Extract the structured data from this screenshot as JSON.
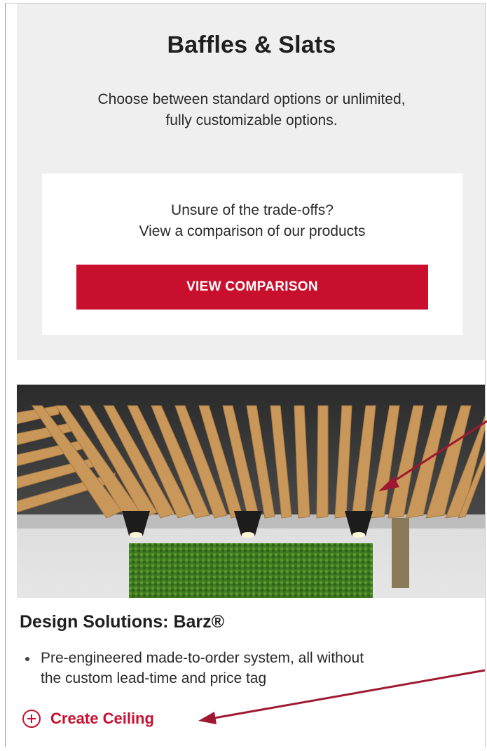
{
  "hero": {
    "title": "Baffles & Slats",
    "subtitle_line1": "Choose between standard options or unlimited,",
    "subtitle_line2": "fully customizable options."
  },
  "comparison": {
    "line1": "Unsure of the trade-offs?",
    "line2": "View a comparison of our products",
    "button_label": "VIEW COMPARISON"
  },
  "product": {
    "title": "Design Solutions: Barz®",
    "bullets": [
      {
        "line1": "Pre-engineered made-to-order system, all without",
        "line2": "the custom lead-time and price tag"
      }
    ],
    "cta_label": "Create Ceiling",
    "cta_icon": "plus-circle-icon"
  },
  "colors": {
    "accent": "#c8102e",
    "hero_bg": "#efefef",
    "annotation_arrow": "#a01830"
  }
}
